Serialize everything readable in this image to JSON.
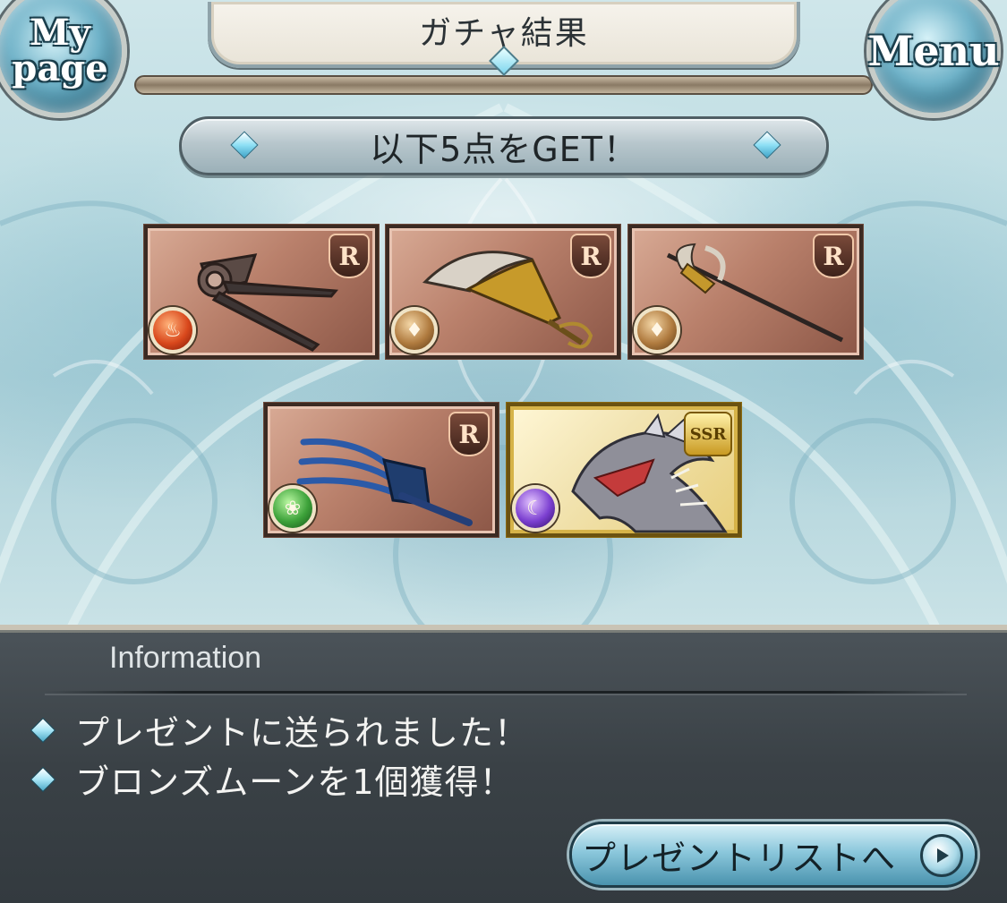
{
  "header": {
    "title": "ガチャ結果",
    "mypage_label": "My page",
    "menu_label": "Menu"
  },
  "banner": {
    "text": "以下5点をGET！"
  },
  "items": [
    {
      "rarity": "R",
      "element": "fire",
      "weapon_icon": "scissor-blade-icon"
    },
    {
      "rarity": "R",
      "element": "earth",
      "weapon_icon": "scimitar-icon"
    },
    {
      "rarity": "R",
      "element": "earth",
      "weapon_icon": "halberd-icon"
    },
    {
      "rarity": "R",
      "element": "wind",
      "weapon_icon": "claw-icon"
    },
    {
      "rarity": "SSR",
      "element": "dark",
      "weapon_icon": "dragon-summon-icon"
    }
  ],
  "info": {
    "title": "Information",
    "messages": [
      "プレゼントに送られました！",
      "ブロンズムーンを1個獲得！"
    ],
    "button_label": "プレゼントリストへ"
  },
  "colors": {
    "r_card": "#b9806b",
    "ssr_card": "#f2e4b2",
    "panel": "#3a4146",
    "accent": "#8cc8dc"
  }
}
